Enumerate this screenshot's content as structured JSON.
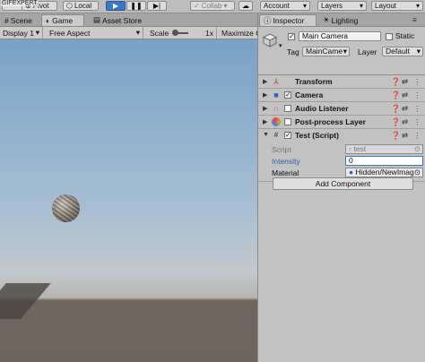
{
  "watermark": "GIFEXPERT",
  "toolbar": {
    "pivot_label": "Pivot",
    "local_label": "Local",
    "collab_label": "Collab",
    "account_label": "Account",
    "layers_label": "Layers",
    "layout_label": "Layout",
    "play_icon": "play-icon",
    "pause_icon": "pause-icon",
    "step_icon": "step-icon"
  },
  "left_tabs": [
    {
      "label": "Scene",
      "icon": "scene-grid-icon"
    },
    {
      "label": "Game",
      "icon": "game-controller-icon"
    },
    {
      "label": "Asset Store",
      "icon": "store-icon"
    }
  ],
  "game_bar": {
    "display": "Display 1",
    "aspect": "Free Aspect",
    "scale_label": "Scale",
    "scale_value": "1x",
    "maximize": "Maximize O"
  },
  "right_tabs": [
    {
      "label": "Inspector",
      "icon": "info-icon"
    },
    {
      "label": "Lighting",
      "icon": "lightbulb-icon"
    }
  ],
  "inspector": {
    "object_name": "Main Camera",
    "static_label": "Static",
    "tag_label": "Tag",
    "tag_value": "MainCame",
    "layer_label": "Layer",
    "layer_value": "Default",
    "components": [
      {
        "name": "Transform",
        "icon": "transform-icon",
        "has_checkbox": false
      },
      {
        "name": "Camera",
        "icon": "camera-icon",
        "has_checkbox": true
      },
      {
        "name": "Audio Listener",
        "icon": "headphones-icon",
        "has_checkbox": true
      },
      {
        "name": "Post-process Layer",
        "icon": "post-process-icon",
        "has_checkbox": true
      },
      {
        "name": "Test (Script)",
        "icon": "script-icon",
        "has_checkbox": true
      }
    ],
    "script_label": "Script",
    "script_value": "test",
    "intensity_label": "Intensity",
    "intensity_value": "0",
    "material_label": "Material",
    "material_value": "Hidden/NewImag",
    "add_component": "Add Component"
  },
  "colors": {
    "play_active": "#3d77c3",
    "intensity_label": "#2f5fa8",
    "sky_top": "#7aa1c5",
    "ground": "#6d655c"
  }
}
